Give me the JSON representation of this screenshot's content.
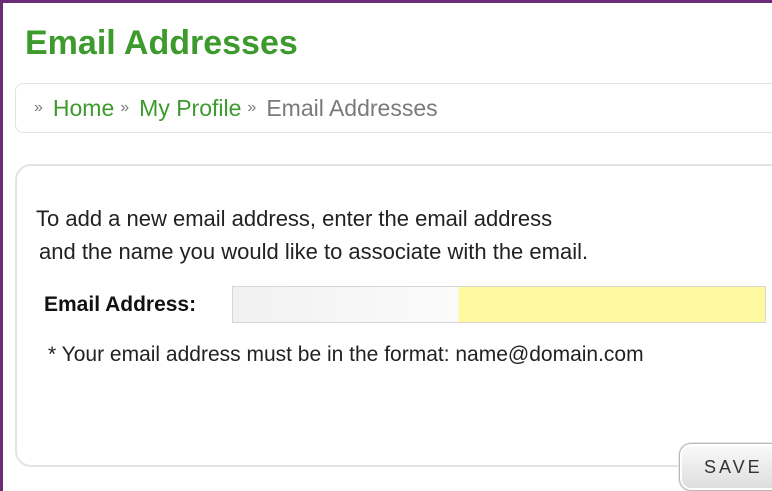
{
  "page": {
    "title": "Email Addresses"
  },
  "breadcrumb": {
    "separator": "»",
    "items": [
      {
        "label": "Home"
      },
      {
        "label": "My Profile"
      },
      {
        "label": "Email Addresses"
      }
    ]
  },
  "form": {
    "instructions_line1": "To add a new email address, enter the email address",
    "instructions_line2": "and the name you would like to associate with the email.",
    "email_label": "Email Address:",
    "email_value": "",
    "hint": "* Your email address must be in the format: name@domain.com",
    "save_label": "SAVE"
  },
  "colors": {
    "title_green": "#3d9a2d",
    "window_border": "#6b2d7a",
    "input_highlight": "#fff9a0"
  }
}
